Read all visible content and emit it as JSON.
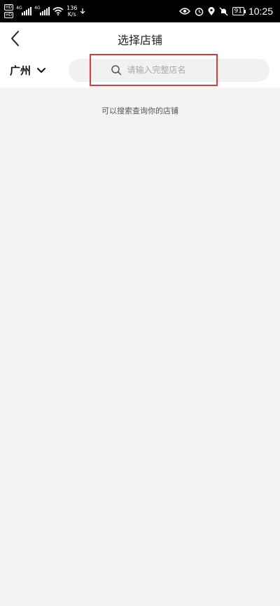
{
  "status_bar": {
    "speed_value": "136",
    "speed_unit": "K/s",
    "signal_tag": "4G",
    "battery": "91",
    "time": "10:25"
  },
  "header": {
    "title": "选择店铺"
  },
  "search_row": {
    "city": "广州",
    "placeholder": "请输入完整店名"
  },
  "content": {
    "hint": "可以搜索查询你的店铺"
  },
  "colors": {
    "highlight_border": "#e03a3a",
    "background": "#f4f4f4"
  }
}
